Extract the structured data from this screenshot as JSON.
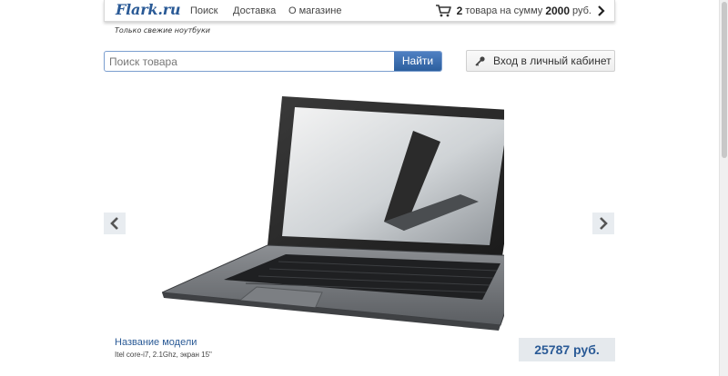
{
  "header": {
    "logo": "Flark.ru",
    "nav": [
      {
        "label": "Поиск"
      },
      {
        "label": "Доставка"
      },
      {
        "label": "О магазине"
      }
    ],
    "cart": {
      "count": "2",
      "text": "товара на сумму",
      "sum": "2000",
      "currency": "руб."
    }
  },
  "tagline": "Только свежие ноутбуки",
  "search": {
    "placeholder": "Поиск товара",
    "button_label": "Найти"
  },
  "login": {
    "label": "Вход в личный кабинет"
  },
  "product": {
    "name": "Название модели",
    "specs": "Itel core-i7, 2.1Ghz, экран 15\"",
    "price": "25787 руб."
  },
  "colors": {
    "accent": "#2a5a96",
    "search_button": "#3a6db0",
    "price_bg": "#e5e9ed"
  }
}
